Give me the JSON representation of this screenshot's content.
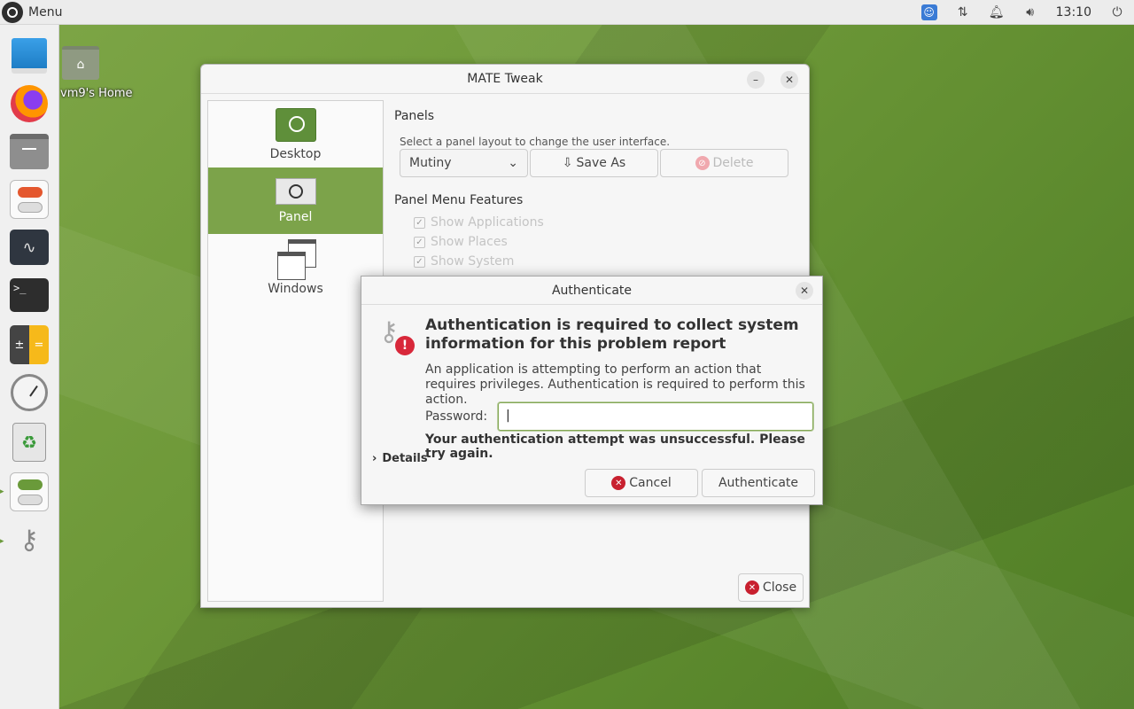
{
  "topbar": {
    "menu_label": "Menu",
    "clock": "13:10"
  },
  "desktop": {
    "home_label": "vm9's Home"
  },
  "tweak": {
    "title": "MATE Tweak",
    "sidebar": [
      {
        "label": "Desktop",
        "active": false
      },
      {
        "label": "Panel",
        "active": true
      },
      {
        "label": "Windows",
        "active": false
      }
    ],
    "panels_heading": "Panels",
    "panels_sub": "Select a panel layout to change the user interface.",
    "layout_value": "Mutiny",
    "save_as_label": "Save As",
    "delete_label": "Delete",
    "menu_features_heading": "Panel Menu Features",
    "features": [
      "Show Applications",
      "Show Places",
      "Show System"
    ],
    "close_label": "Close"
  },
  "auth": {
    "title": "Authenticate",
    "heading": "Authentication is required to collect system information for this problem report",
    "body": "An application is attempting to perform an action that requires privileges. Authentication is required to perform this action.",
    "password_label": "Password:",
    "password_value": "",
    "error": "Your authentication attempt was unsuccessful. Please try again.",
    "details_label": "Details",
    "cancel_label": "Cancel",
    "authenticate_label": "Authenticate"
  },
  "colors": {
    "accent": "#7ca34a",
    "error_red": "#c8202f"
  }
}
